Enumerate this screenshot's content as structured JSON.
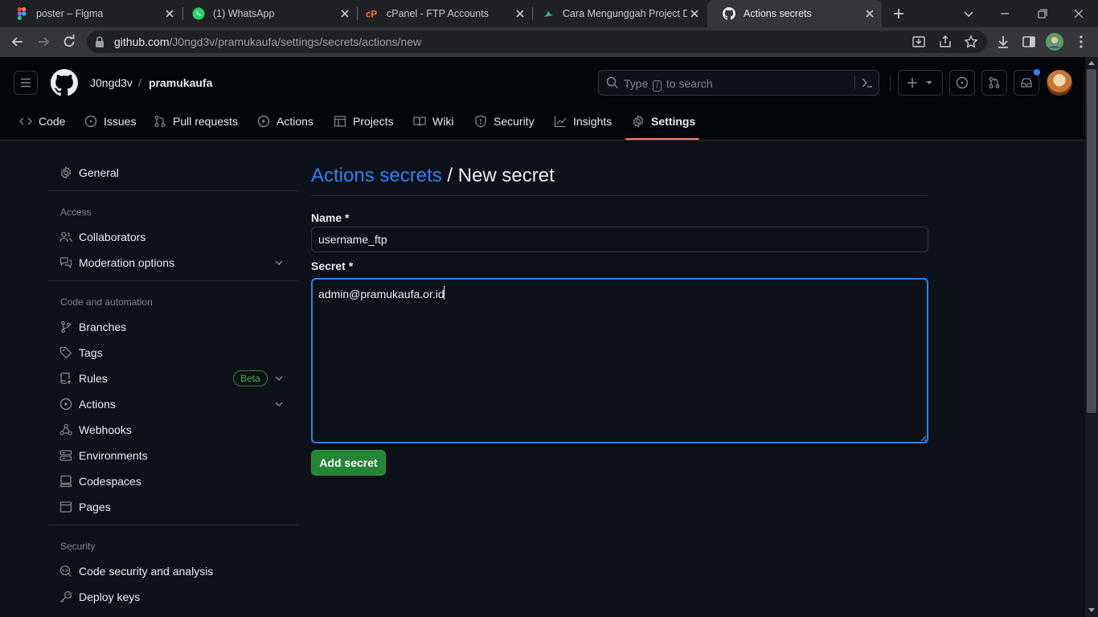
{
  "browser": {
    "tabs": [
      {
        "title": "poster – Figma",
        "icon": "figma-icon"
      },
      {
        "title": "(1) WhatsApp",
        "icon": "whatsapp-icon"
      },
      {
        "title": "cPanel - FTP Accounts",
        "icon": "cpanel-icon"
      },
      {
        "title": "Cara Mengunggah Project D",
        "icon": "site-icon"
      },
      {
        "title": "Actions secrets",
        "icon": "github-icon",
        "active": true
      }
    ],
    "url_host": "github.com",
    "url_path": "/J0ngd3v/pramukaufa/settings/secrets/actions/new"
  },
  "header": {
    "owner": "J0ngd3v",
    "separator": "/",
    "repo": "pramukaufa",
    "search_prefix": "Type",
    "search_key": "/",
    "search_suffix": "to search"
  },
  "repo_nav": [
    {
      "label": "Code",
      "icon": "code-icon"
    },
    {
      "label": "Issues",
      "icon": "issue-icon"
    },
    {
      "label": "Pull requests",
      "icon": "pull-request-icon"
    },
    {
      "label": "Actions",
      "icon": "play-icon"
    },
    {
      "label": "Projects",
      "icon": "table-icon"
    },
    {
      "label": "Wiki",
      "icon": "book-icon"
    },
    {
      "label": "Security",
      "icon": "shield-icon"
    },
    {
      "label": "Insights",
      "icon": "graph-icon"
    },
    {
      "label": "Settings",
      "icon": "gear-icon",
      "selected": true
    }
  ],
  "sidebar": {
    "general": "General",
    "access_heading": "Access",
    "collaborators": "Collaborators",
    "moderation": "Moderation options",
    "code_heading": "Code and automation",
    "branches": "Branches",
    "tags": "Tags",
    "rules": "Rules",
    "beta": "Beta",
    "actions": "Actions",
    "webhooks": "Webhooks",
    "environments": "Environments",
    "codespaces": "Codespaces",
    "pages": "Pages",
    "security_heading": "Security",
    "code_security": "Code security and analysis",
    "deploy_keys": "Deploy keys"
  },
  "main": {
    "title_link": "Actions secrets",
    "title_rest": " / New secret",
    "name_label": "Name *",
    "name_value": "username_ftp",
    "secret_label": "Secret *",
    "secret_value": "admin@pramukaufa.or.id",
    "submit_label": "Add secret"
  },
  "colors": {
    "accent": "#2f81f7",
    "primary_button": "#238636",
    "selected_underline": "#f78166",
    "background": "#0d1117"
  }
}
